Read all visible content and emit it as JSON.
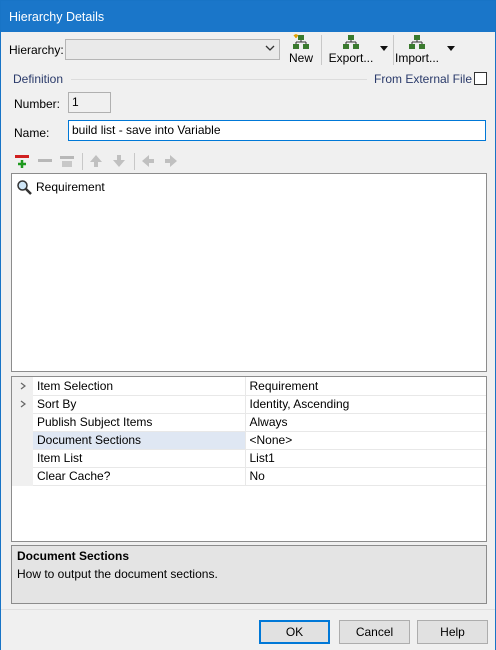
{
  "window": {
    "title": "Hierarchy Details"
  },
  "toolbar": {
    "hierarchy_label": "Hierarchy:",
    "hierarchy_value": "",
    "new_label": "New",
    "export_label": "Export...",
    "import_label": "Import..."
  },
  "definition": {
    "group_label": "Definition",
    "external_file_label": "From External File",
    "external_file_checked": false,
    "number_label": "Number:",
    "number_value": "1",
    "name_label": "Name:",
    "name_value": "build list - save into Variable"
  },
  "tree": {
    "items": [
      {
        "label": "Requirement",
        "icon": "search-icon"
      }
    ]
  },
  "properties": [
    {
      "name": "Item Selection",
      "value": "Requirement",
      "expandable": true
    },
    {
      "name": "Sort By",
      "value": "Identity, Ascending",
      "expandable": true
    },
    {
      "name": "Publish Subject Items",
      "value": "Always",
      "expandable": false
    },
    {
      "name": "Document Sections",
      "value": "<None>",
      "expandable": false,
      "selected": true
    },
    {
      "name": "Item List",
      "value": "List1",
      "expandable": false
    },
    {
      "name": "Clear Cache?",
      "value": "No",
      "expandable": false
    }
  ],
  "description": {
    "title": "Document Sections",
    "text": "How to output the document sections."
  },
  "buttons": {
    "ok": "OK",
    "cancel": "Cancel",
    "help": "Help"
  },
  "colors": {
    "titlebar": "#1a76c9",
    "accent": "#0078d7",
    "selected_row": "#dfe7f3"
  }
}
